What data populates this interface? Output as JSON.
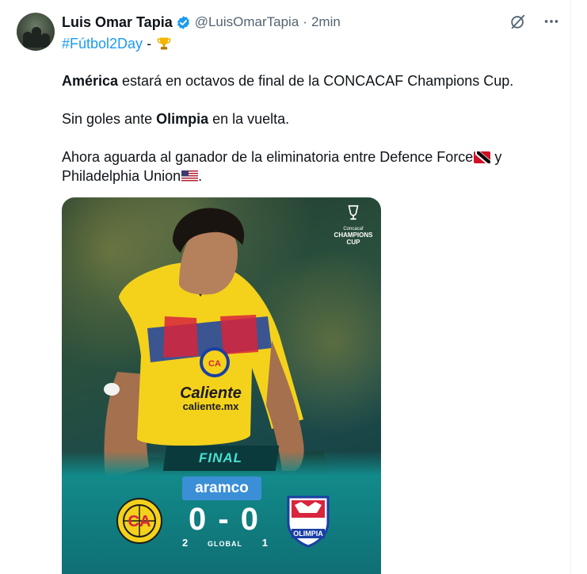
{
  "tweet": {
    "author_name": "Luis Omar Tapia",
    "handle": "@LuisOmarTapia",
    "separator": "·",
    "time": "2min",
    "hashtag": "#Fútbol2Day",
    "hashtag_suffix": "-",
    "body": {
      "p1_bold": "América",
      "p1_rest": " estará en octavos de final de la CONCACAF Champions Cup.",
      "p2_start": "Sin goles ante ",
      "p2_bold": "Olimpia",
      "p2_rest": " en la vuelta.",
      "p3_start": "Ahora aguarda al ganador de la eliminatoria entre Defence Force",
      "p3_mid": " y",
      "p3_line2": "Philadelphia Union",
      "p3_end": "."
    }
  },
  "media": {
    "competition_logo": {
      "line_small": "Concacaf",
      "line1": "CHAMPIONS",
      "line2": "CUP"
    },
    "final_label": "FINAL",
    "sponsor": "aramco",
    "score": "0 - 0",
    "aggregate": {
      "home": "2",
      "label": "GLOBAL",
      "away": "1"
    },
    "jersey_text": "caliente.mx",
    "away_crest_text": "OLIMPIA"
  },
  "icons": {
    "verified": "verified-badge-icon",
    "grok": "grok-icon",
    "more": "more-icon",
    "trophy": "trophy-icon",
    "flag_tt": "trinidad-tobago-flag-icon",
    "flag_us": "us-flag-icon"
  },
  "colors": {
    "link": "#1d9bf0",
    "text": "#0f1419",
    "muted": "#536471",
    "jersey_yellow": "#f4d21c"
  }
}
